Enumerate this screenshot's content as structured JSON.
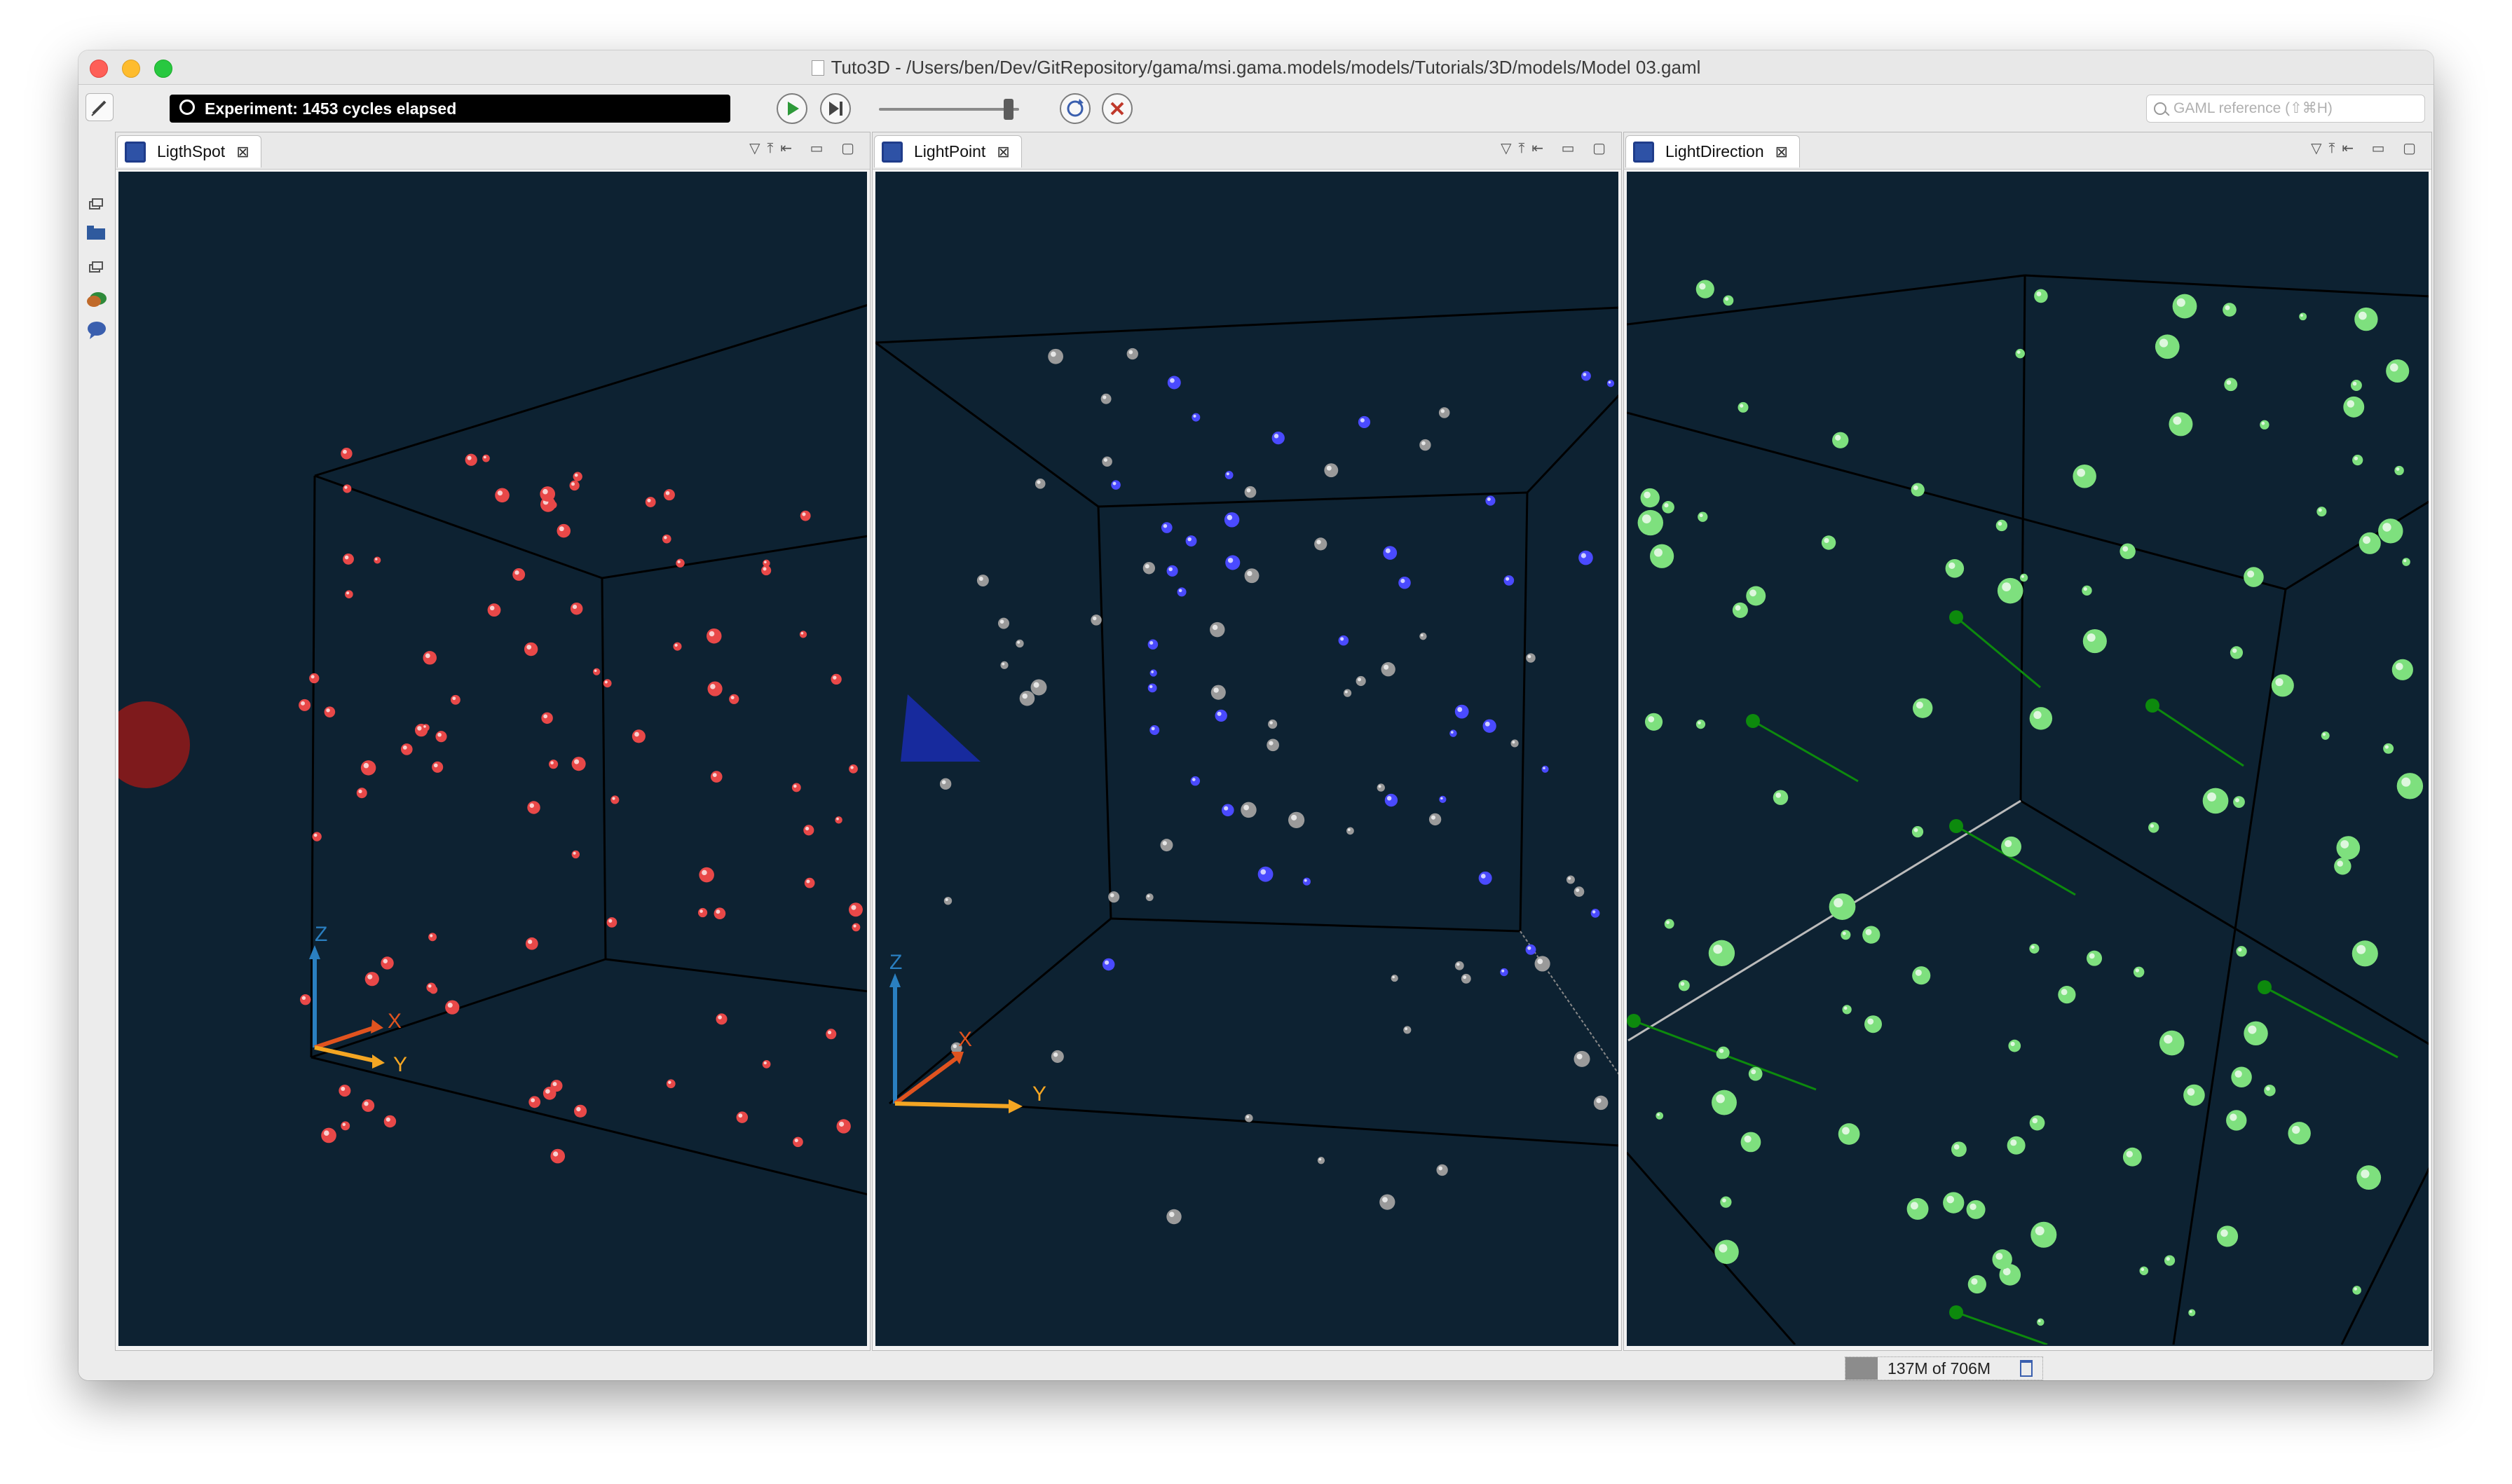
{
  "window": {
    "title": "Tuto3D - /Users/ben/Dev/GitRepository/gama/msi.gama.models/models/Tutorials/3D/models/Model 03.gaml"
  },
  "toolbar": {
    "experiment_status": "Experiment: 1453 cycles elapsed",
    "search_placeholder": "GAML reference (⇧⌘H)"
  },
  "panels": [
    {
      "tab_label": "LigthSpot",
      "sphere_color": "#e84848",
      "axes": {
        "z": "Z",
        "x": "X",
        "y": "Y"
      }
    },
    {
      "tab_label": "LightPoint",
      "sphere_color": "#4a4aff",
      "secondary_color": "#9a9a9a",
      "axes": {
        "z": "Z",
        "x": "X",
        "y": "Y"
      }
    },
    {
      "tab_label": "LightDirection",
      "sphere_color": "#7ee07e",
      "source_color": "#0d8a0d"
    }
  ],
  "status": {
    "memory": "137M of 706M"
  },
  "colors": {
    "scene_background": "#0d2232",
    "axis_z": "#2a7fc0",
    "axis_x": "#e0531f",
    "axis_y": "#f4a623"
  }
}
